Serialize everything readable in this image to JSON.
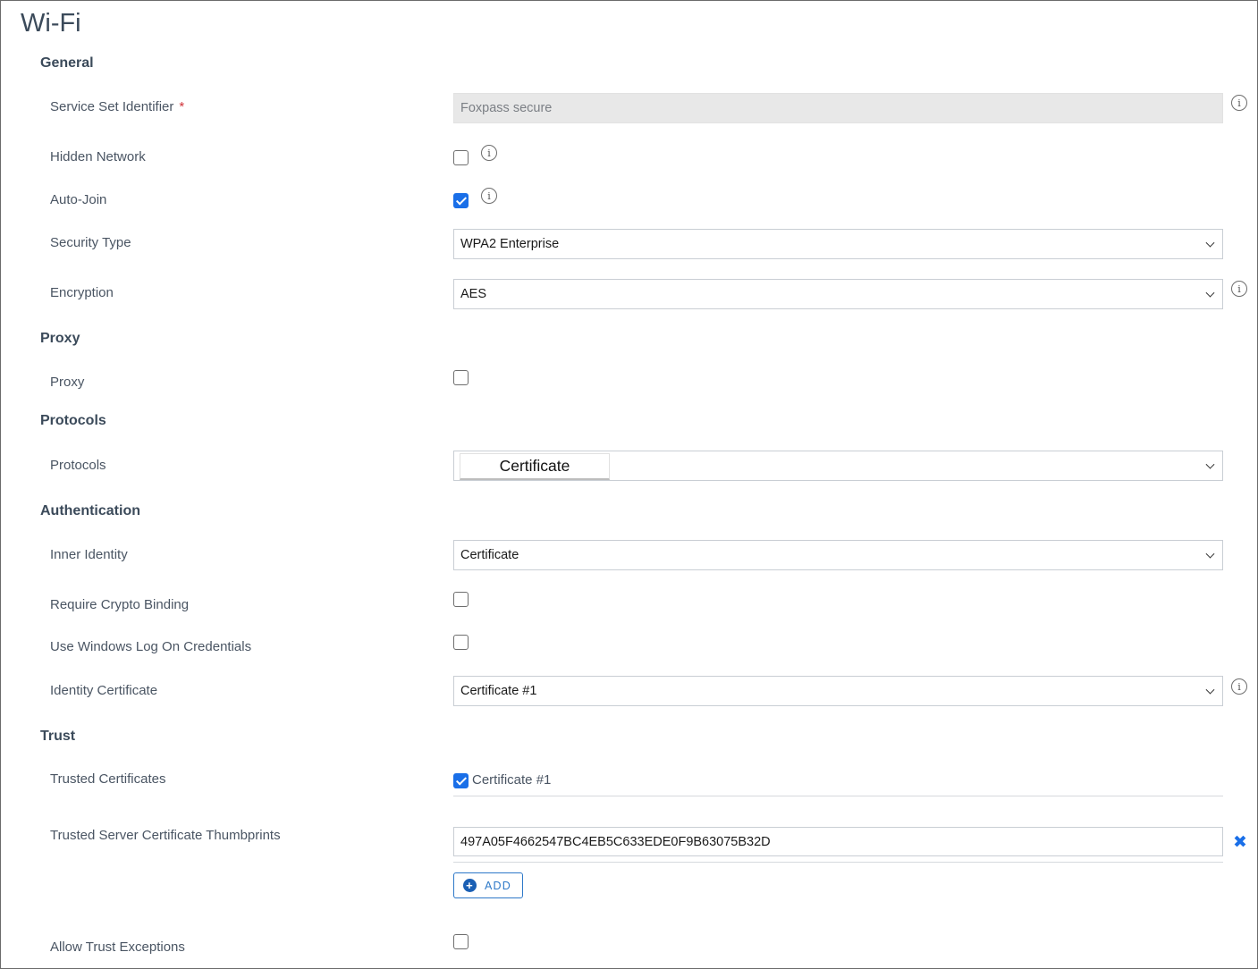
{
  "title": "Wi-Fi",
  "sections": {
    "general": "General",
    "proxy": "Proxy",
    "protocols": "Protocols",
    "authentication": "Authentication",
    "trust": "Trust"
  },
  "fields": {
    "ssid": {
      "label": "Service Set Identifier",
      "required_mark": "*",
      "value": "Foxpass secure"
    },
    "hidden_network": {
      "label": "Hidden Network",
      "checked": false
    },
    "auto_join": {
      "label": "Auto-Join",
      "checked": true
    },
    "security_type": {
      "label": "Security Type",
      "value": "WPA2 Enterprise"
    },
    "encryption": {
      "label": "Encryption",
      "value": "AES"
    },
    "proxy": {
      "label": "Proxy",
      "checked": false
    },
    "protocols": {
      "label": "Protocols",
      "chip": "Certificate"
    },
    "inner_identity": {
      "label": "Inner Identity",
      "value": "Certificate"
    },
    "require_crypto_binding": {
      "label": "Require Crypto Binding",
      "checked": false
    },
    "use_windows_logon": {
      "label": "Use Windows Log On Credentials",
      "checked": false
    },
    "identity_certificate": {
      "label": "Identity Certificate",
      "value": "Certificate #1"
    },
    "trusted_certificates": {
      "label": "Trusted Certificates",
      "option": "Certificate #1",
      "checked": true
    },
    "thumbprints": {
      "label": "Trusted Server Certificate Thumbprints",
      "value": "497A05F4662547BC4EB5C633EDE0F9B63075B32D",
      "add_label": "ADD",
      "remove_icon": "close-x-icon"
    },
    "allow_trust_exceptions": {
      "label": "Allow Trust Exceptions",
      "checked": false
    }
  },
  "icons": {
    "info": "i",
    "remove": "✖",
    "add": "+"
  },
  "colors": {
    "accent": "#1a6fe8",
    "required": "#d0333a",
    "heading": "#3b4a5a"
  }
}
